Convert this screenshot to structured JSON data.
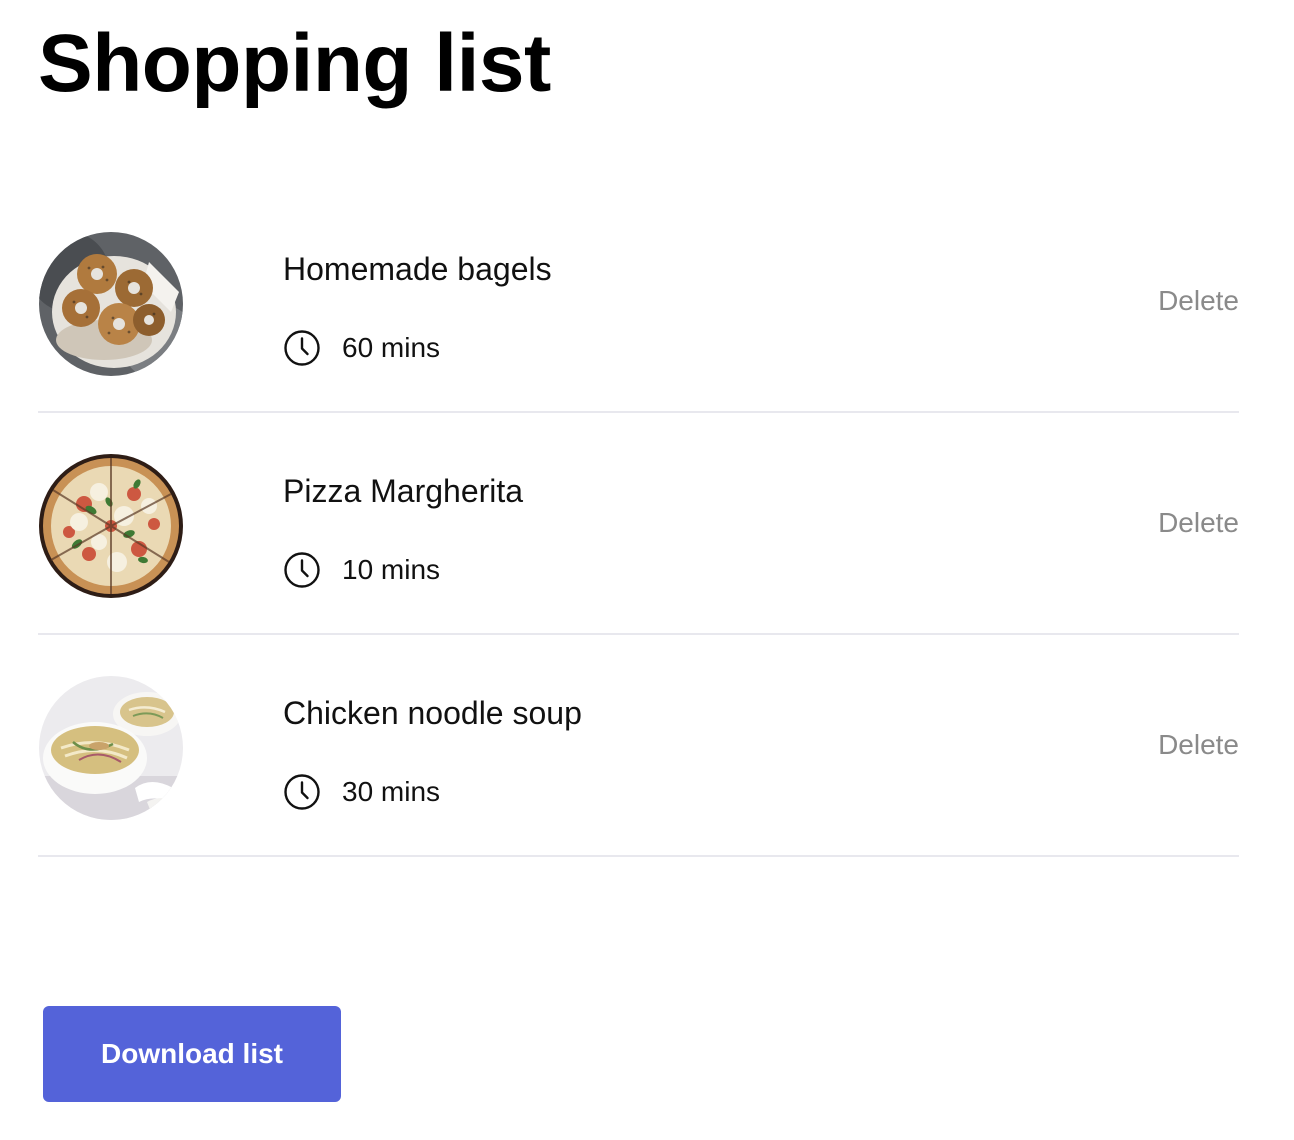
{
  "page": {
    "title": "Shopping list"
  },
  "recipes": [
    {
      "name": "Homemade bagels",
      "time": "60 mins",
      "image": "bagels-photo",
      "delete_label": "Delete"
    },
    {
      "name": "Pizza Margherita",
      "time": "10 mins",
      "image": "pizza-photo",
      "delete_label": "Delete"
    },
    {
      "name": "Chicken noodle soup",
      "time": "30 mins",
      "image": "soup-photo",
      "delete_label": "Delete"
    }
  ],
  "actions": {
    "download_label": "Download list"
  },
  "icons": {
    "time": "clock-icon"
  },
  "colors": {
    "accent": "#5463d9",
    "muted_text": "#8a8a8a",
    "divider": "#e8e8ee"
  }
}
